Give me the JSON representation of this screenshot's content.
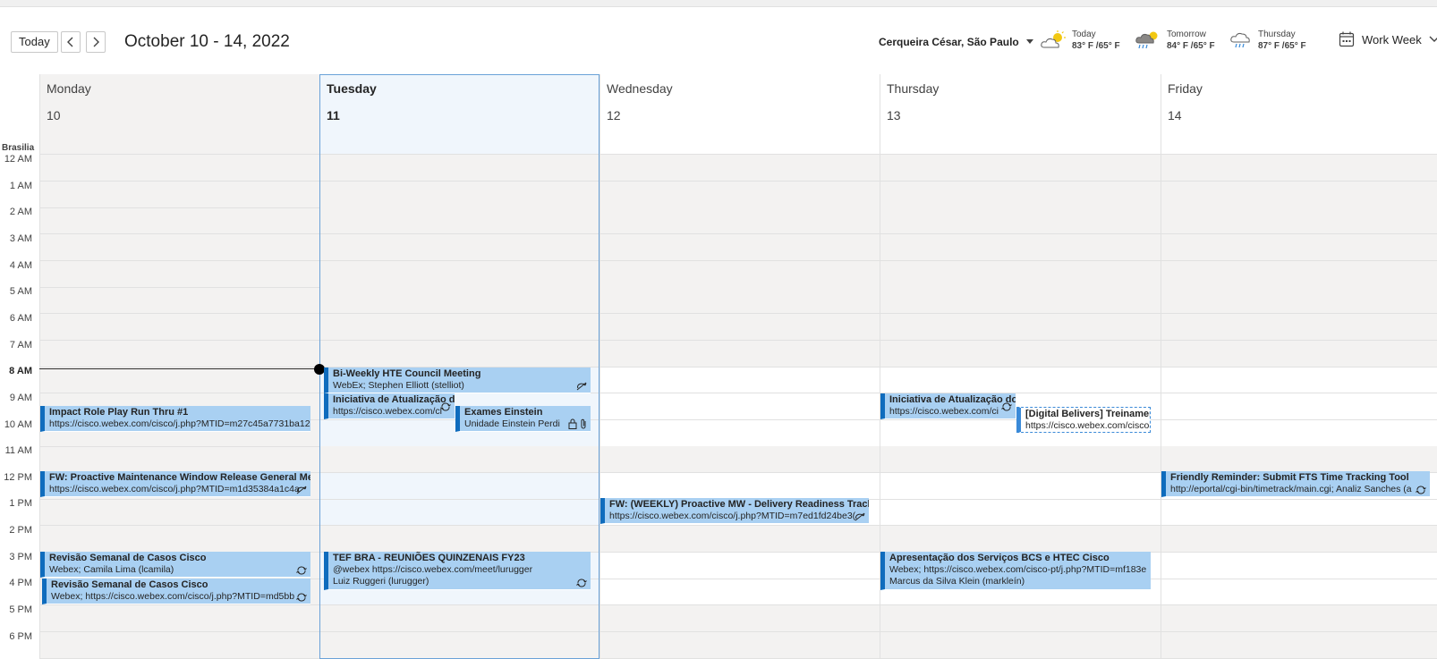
{
  "toolbar": {
    "today_label": "Today",
    "date_range": "October 10 - 14, 2022",
    "location": "Cerqueira César, São Paulo",
    "weather": [
      {
        "label": "Today",
        "temps": "83° F /65° F",
        "icon": "partly-sunny-icon"
      },
      {
        "label": "Tomorrow",
        "temps": "84° F /65° F",
        "icon": "rain-sun-icon"
      },
      {
        "label": "Thursday",
        "temps": "87° F /65° F",
        "icon": "rain-icon"
      }
    ],
    "view_label": "Work Week"
  },
  "timezone_label": "Brasilia",
  "days": [
    {
      "name": "Monday",
      "date": "10"
    },
    {
      "name": "Tuesday",
      "date": "11"
    },
    {
      "name": "Wednesday",
      "date": "12"
    },
    {
      "name": "Thursday",
      "date": "13"
    },
    {
      "name": "Friday",
      "date": "14"
    }
  ],
  "hours": [
    "12 AM",
    "1 AM",
    "2 AM",
    "3 AM",
    "4 AM",
    "5 AM",
    "6 AM",
    "7 AM",
    "8 AM",
    "9 AM",
    "10 AM",
    "11 AM",
    "12 PM",
    "1 PM",
    "2 PM",
    "3 PM",
    "4 PM",
    "5 PM",
    "6 PM"
  ],
  "events": {
    "mon_impact": {
      "title": "Impact Role Play Run Thru #1",
      "line1": "https://cisco.webex.com/cisco/j.php?MTID=m27c45a7731ba12"
    },
    "mon_fw": {
      "title": "FW: Proactive Maintenance Window Release General Meet",
      "line1": "https://cisco.webex.com/cisco/j.php?MTID=m1d35384a1c4a"
    },
    "mon_rev1": {
      "title": "Revisão Semanal de Casos Cisco",
      "line1": "Webex; Camila Lima (lcamila)"
    },
    "mon_rev2": {
      "title": "Revisão Semanal de Casos Cisco",
      "line1": "Webex; https://cisco.webex.com/cisco/j.php?MTID=md5bb"
    },
    "tue_hte": {
      "title": "Bi-Weekly HTE Council Meeting",
      "line1": "WebEx; Stephen Elliott (stelliot)"
    },
    "tue_inic": {
      "title": "Iniciativa de Atualização do",
      "line1": "https://cisco.webex.com/ci"
    },
    "tue_exames": {
      "title": "Exames Einstein",
      "line1": "Unidade Einstein Perdi"
    },
    "tue_tef": {
      "title": "TEF BRA - REUNIÕES QUINZENAIS FY23",
      "line1": "@webex https://cisco.webex.com/meet/lurugger",
      "line2": "Luiz Ruggeri (lurugger)"
    },
    "wed_fw": {
      "title": "FW: (WEEKLY) Proactive MW - Delivery Readiness Track M",
      "line1": "https://cisco.webex.com/cisco/j.php?MTID=m7ed1fd24be3("
    },
    "thu_inic": {
      "title": "Iniciativa de Atualização do",
      "line1": "https://cisco.webex.com/ci"
    },
    "thu_digital": {
      "title": "[Digital Belivers] Treinamen",
      "line1": "https://cisco.webex.com/cisco"
    },
    "thu_bcs": {
      "title": "Apresentação dos Serviços BCS e HTEC Cisco",
      "line1": "Webex; https://cisco.webex.com/cisco-pt/j.php?MTID=mf183e",
      "line2": "Marcus da Silva Klein (markleín)"
    },
    "fri_reminder": {
      "title": "Friendly Reminder: Submit FTS Time Tracking Tool",
      "line1": "http://eportal/cgi-bin/timetrack/main.cgi; Analiz Sanches (a"
    }
  },
  "colors": {
    "event_bg": "#a9d0f2",
    "event_accent": "#0f6cbd",
    "today_border": "#6aa2d8"
  }
}
